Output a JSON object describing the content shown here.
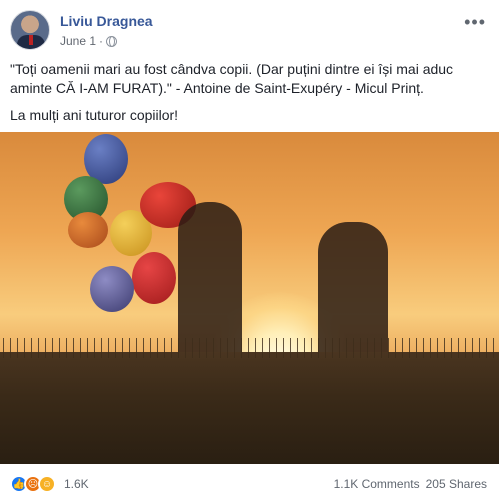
{
  "author": {
    "name": "Liviu Dragnea",
    "date": "June 1",
    "privacy_icon": "globe-icon"
  },
  "post": {
    "text_line1": "\"Toți oamenii mari au fost cândva copii. (Dar puțini dintre ei își mai aduc aminte CĂ I-AM FURAT).\" - Antoine de Saint-Exupéry - Micul Prinț.",
    "text_line2": "La mulți ani tuturor copiilor!"
  },
  "footer": {
    "reaction_icons": [
      "like-icon",
      "angry-icon",
      "haha-icon"
    ],
    "reaction_count": "1.6K",
    "comments": "1.1K Comments",
    "shares": "205 Shares"
  },
  "colors": {
    "link": "#385898",
    "meta": "#616770",
    "like": "#1877f2"
  }
}
